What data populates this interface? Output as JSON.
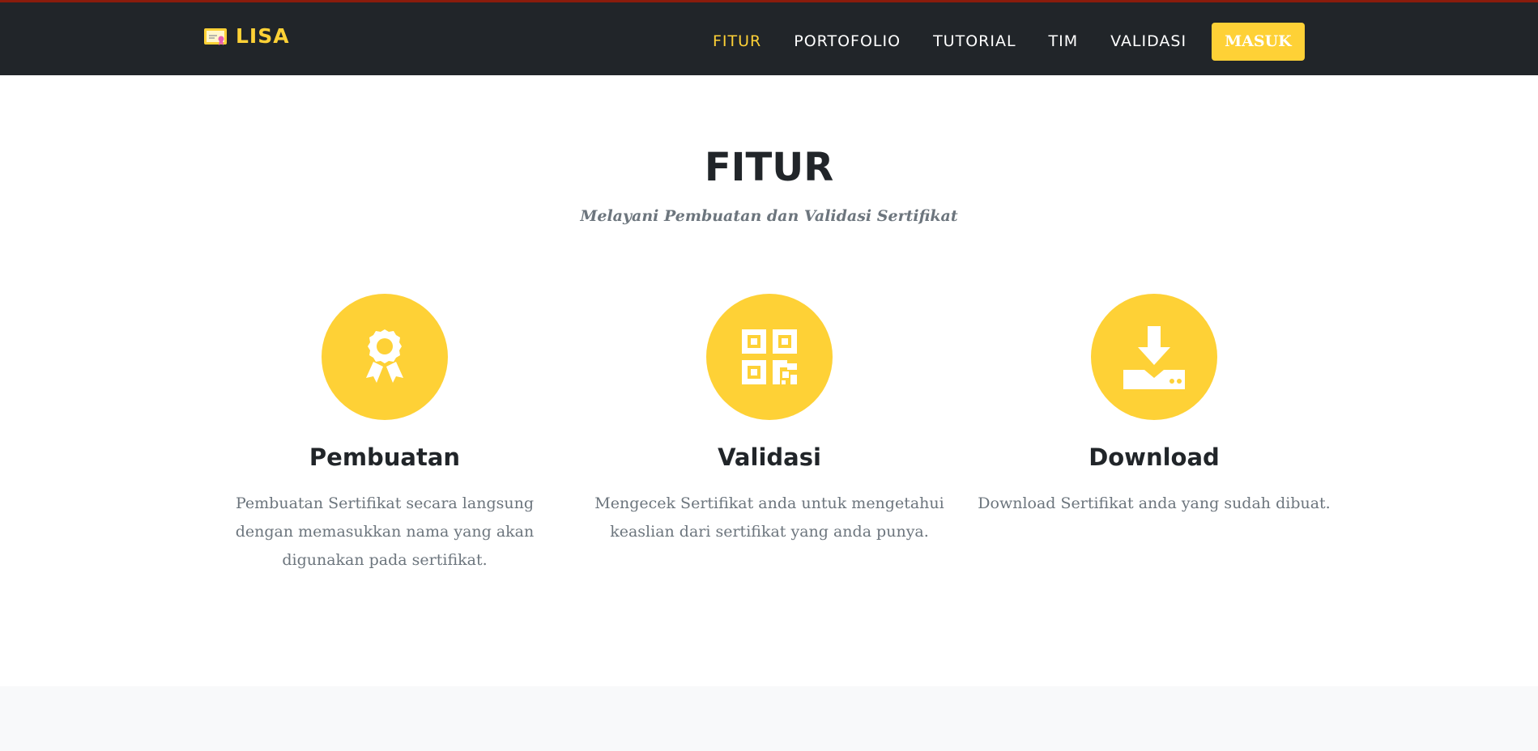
{
  "navbar": {
    "brand": "LISA",
    "links": [
      "FITUR",
      "PORTOFOLIO",
      "TUTORIAL",
      "TIM",
      "VALIDASI"
    ],
    "active_link": "FITUR",
    "login_label": "MASUK"
  },
  "section": {
    "title": "FITUR",
    "subtitle": "Melayani Pembuatan dan Validasi Sertifikat"
  },
  "features": [
    {
      "icon": "award-icon",
      "title": "Pembuatan",
      "description": "Pembuatan Sertifikat secara langsung dengan memasukkan nama yang akan digunakan pada sertifikat."
    },
    {
      "icon": "qrcode-icon",
      "title": "Validasi",
      "description": "Mengecek Sertifikat anda untuk mengetahui keaslian dari sertifikat yang anda punya."
    },
    {
      "icon": "download-icon",
      "title": "Download",
      "description": "Download Sertifikat anda yang sudah dibuat."
    }
  ],
  "colors": {
    "accent": "#fed136",
    "navbar_bg": "#212529",
    "heading": "#212529",
    "muted_text": "#6c757d"
  }
}
